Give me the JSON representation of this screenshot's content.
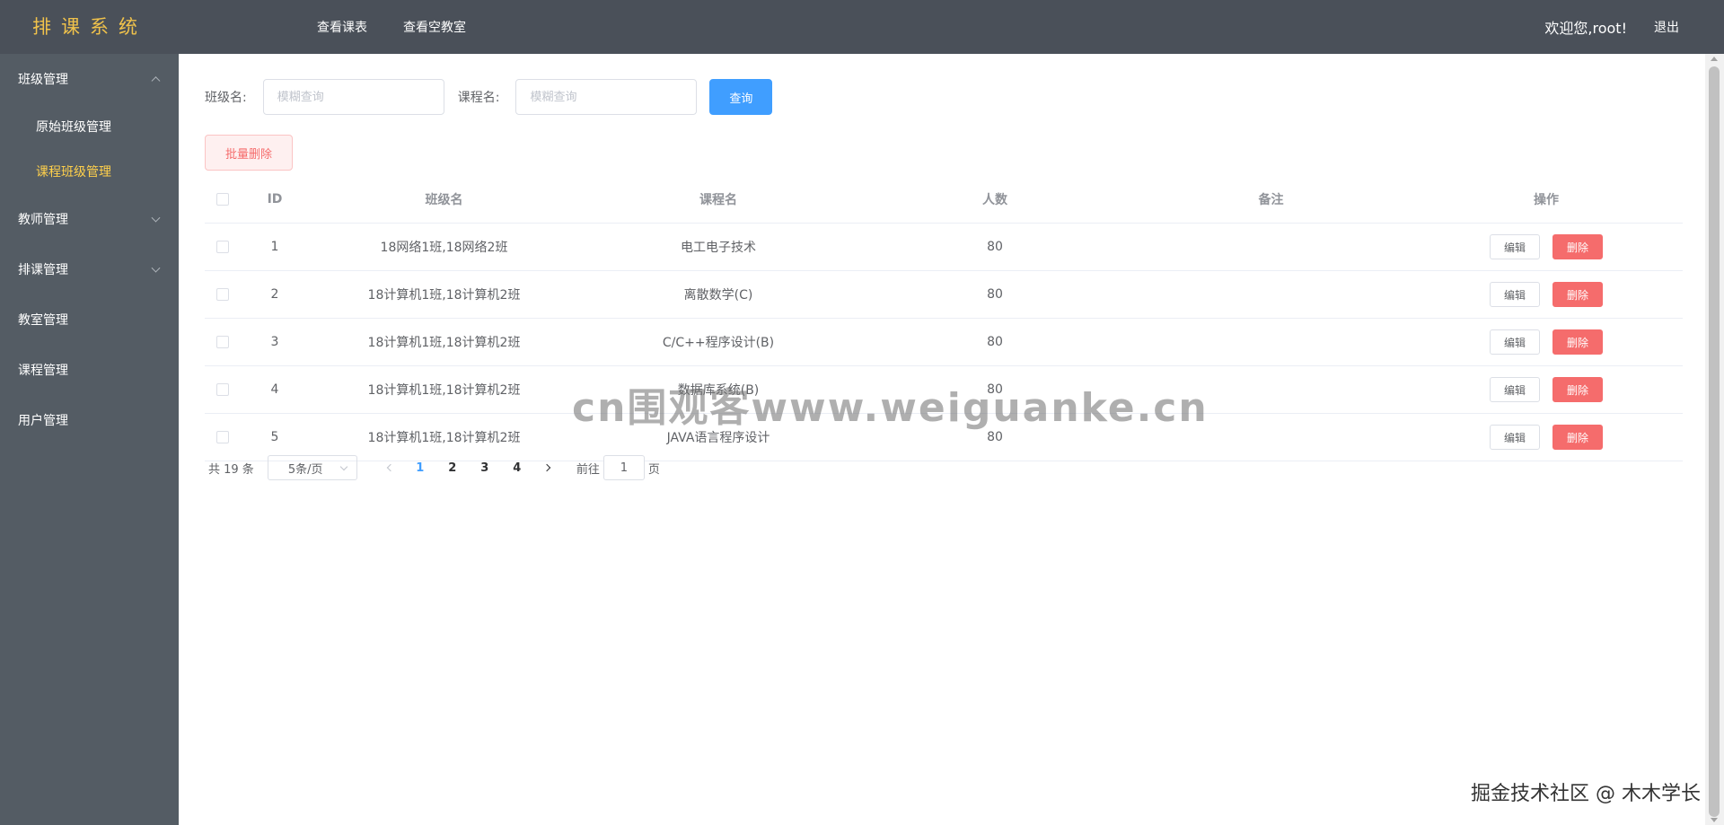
{
  "header": {
    "brand": "排课系统",
    "nav": [
      "查看课表",
      "查看空教室"
    ],
    "welcome": "欢迎您,root!",
    "logout": "退出"
  },
  "sidebar": {
    "groups": [
      {
        "label": "班级管理",
        "expanded": true,
        "children": [
          "原始班级管理",
          "课程班级管理"
        ],
        "active_child": "课程班级管理"
      },
      {
        "label": "教师管理",
        "expanded": false
      },
      {
        "label": "排课管理",
        "expanded": false
      },
      {
        "label": "教室管理"
      },
      {
        "label": "课程管理"
      },
      {
        "label": "用户管理"
      }
    ]
  },
  "search": {
    "class_label": "班级名:",
    "class_placeholder": "模糊查询",
    "course_label": "课程名:",
    "course_placeholder": "模糊查询",
    "search_button": "查询"
  },
  "batch_delete": "批量删除",
  "table": {
    "headers": [
      "ID",
      "班级名",
      "课程名",
      "人数",
      "备注",
      "操作"
    ],
    "edit_label": "编辑",
    "delete_label": "删除",
    "rows": [
      {
        "id": "1",
        "class": "18网络1班,18网络2班",
        "course": "电工电子技术",
        "num": "80",
        "note": ""
      },
      {
        "id": "2",
        "class": "18计算机1班,18计算机2班",
        "course": "离散数学(C)",
        "num": "80",
        "note": ""
      },
      {
        "id": "3",
        "class": "18计算机1班,18计算机2班",
        "course": "C/C++程序设计(B)",
        "num": "80",
        "note": ""
      },
      {
        "id": "4",
        "class": "18计算机1班,18计算机2班",
        "course": "数据库系统(B)",
        "num": "80",
        "note": ""
      },
      {
        "id": "5",
        "class": "18计算机1班,18计算机2班",
        "course": "JAVA语言程序设计",
        "num": "80",
        "note": ""
      }
    ]
  },
  "pagination": {
    "total": "共 19 条",
    "page_size": "5条/页",
    "pages": [
      "1",
      "2",
      "3",
      "4"
    ],
    "current": "1",
    "goto_prefix": "前往",
    "goto_value": "1",
    "goto_suffix": "页"
  },
  "watermark": "cn围观客www.weiguanke.cn",
  "footer_mark": "掘金技术社区 @ 木木学长",
  "colors": {
    "header_bg": "#4a5059",
    "sidebar_bg": "#545c64",
    "brand": "#f0c24b",
    "active_menu": "#ffd04b",
    "primary": "#409eff",
    "danger": "#f56c6c"
  }
}
